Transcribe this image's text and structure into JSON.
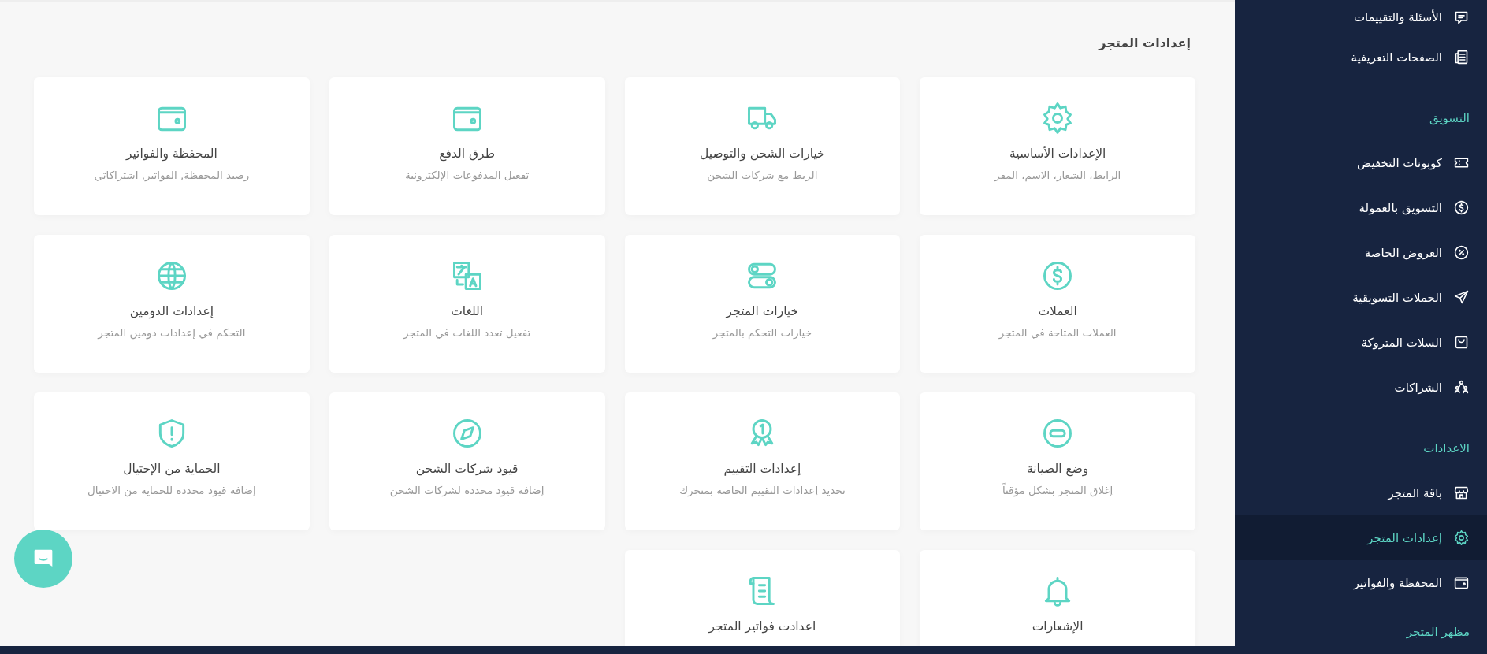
{
  "sidebar": {
    "entries": [
      {
        "kind": "message",
        "label": "الأسئلة والتقييمات",
        "selected": false
      },
      {
        "kind": "pages",
        "label": "الصفحات التعريفية",
        "selected": false
      },
      {
        "kind": "heading",
        "label": "التسويق"
      },
      {
        "kind": "ticket",
        "label": "كوبونات التخفيض",
        "selected": false
      },
      {
        "kind": "commission",
        "label": "التسويق بالعمولة",
        "selected": false
      },
      {
        "kind": "offers",
        "label": "العروض الخاصة",
        "selected": false
      },
      {
        "kind": "send",
        "label": "الحملات التسويقية",
        "selected": false
      },
      {
        "kind": "basket",
        "label": "السلات المتروكة",
        "selected": false
      },
      {
        "kind": "people",
        "label": "الشراكات",
        "selected": false
      },
      {
        "kind": "heading",
        "label": "الاعدادات"
      },
      {
        "kind": "store",
        "label": "باقة المتجر",
        "selected": false
      },
      {
        "kind": "gear",
        "label": "إعدادات المتجر",
        "selected": true
      },
      {
        "kind": "wallet",
        "label": "المحفظة والفواتير",
        "selected": false
      },
      {
        "kind": "heading",
        "label": "مظهر المتجر"
      }
    ]
  },
  "main": {
    "title": "إعدادات المتجر",
    "cards": [
      {
        "kind": "gear",
        "title": "الإعدادات الأساسية",
        "subtitle": "الرابط، الشعار، الاسم، المقر"
      },
      {
        "kind": "truck",
        "title": "خيارات الشحن والتوصيل",
        "subtitle": "الربط مع شركات الشحن"
      },
      {
        "kind": "wallet",
        "title": "طرق الدفع",
        "subtitle": "تفعيل المدفوعات الإلكترونية"
      },
      {
        "kind": "wallet",
        "title": "المحفظة والفواتير",
        "subtitle": "رصيد المحفظة, الفواتير, اشتراكاتي"
      },
      {
        "kind": "dollar",
        "title": "العملات",
        "subtitle": "العملات المتاحة في المتجر"
      },
      {
        "kind": "toggles",
        "title": "خيارات المتجر",
        "subtitle": "خيارات التحكم بالمتجر"
      },
      {
        "kind": "translate",
        "title": "اللغات",
        "subtitle": "تفعيل تعدد اللغات في المتجر"
      },
      {
        "kind": "globe",
        "title": "إعدادات الدومين",
        "subtitle": "التحكم في إعدادات دومين المتجر"
      },
      {
        "kind": "maintenance",
        "title": "وضع الصيانة",
        "subtitle": "إغلاق المتجر بشكل مؤقتاً"
      },
      {
        "kind": "award",
        "title": "إعدادات التقييم",
        "subtitle": "تحديد إعدادات التقييم الخاصة بمتجرك"
      },
      {
        "kind": "compass",
        "title": "قيود شركات الشحن",
        "subtitle": "إضافة قيود محددة لشركات الشحن"
      },
      {
        "kind": "shield",
        "title": "الحماية من الإحتيال",
        "subtitle": "إضافة قيود محددة للحماية من الاحتيال"
      },
      {
        "kind": "bell",
        "title": "الإشعارات"
      },
      {
        "kind": "scroll",
        "title": "اعدادت فواتير المتجر"
      }
    ]
  }
}
